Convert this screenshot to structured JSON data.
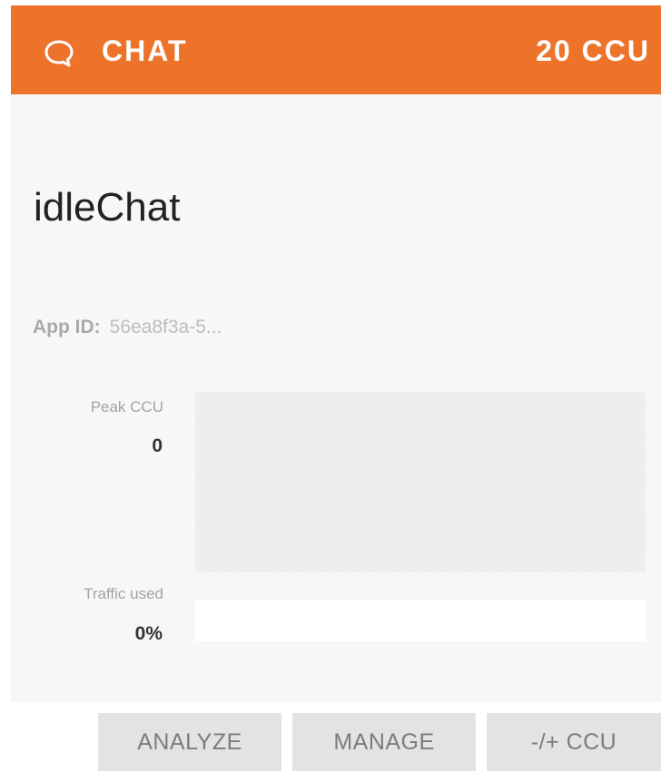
{
  "header": {
    "icon": "chat-bubble-icon",
    "product": "CHAT",
    "ccu": "20 CCU",
    "color": "#ee732a"
  },
  "app": {
    "name": "idleChat",
    "id_label": "App ID:",
    "id_value": "56ea8f3a-5..."
  },
  "stats": {
    "peak_label": "Peak CCU",
    "peak_value": "0",
    "traffic_label": "Traffic used",
    "traffic_value": "0%",
    "traffic_fraction": 0
  },
  "actions": {
    "analyze": "ANALYZE",
    "manage": "MANAGE",
    "ccu": "-/+ CCU"
  }
}
